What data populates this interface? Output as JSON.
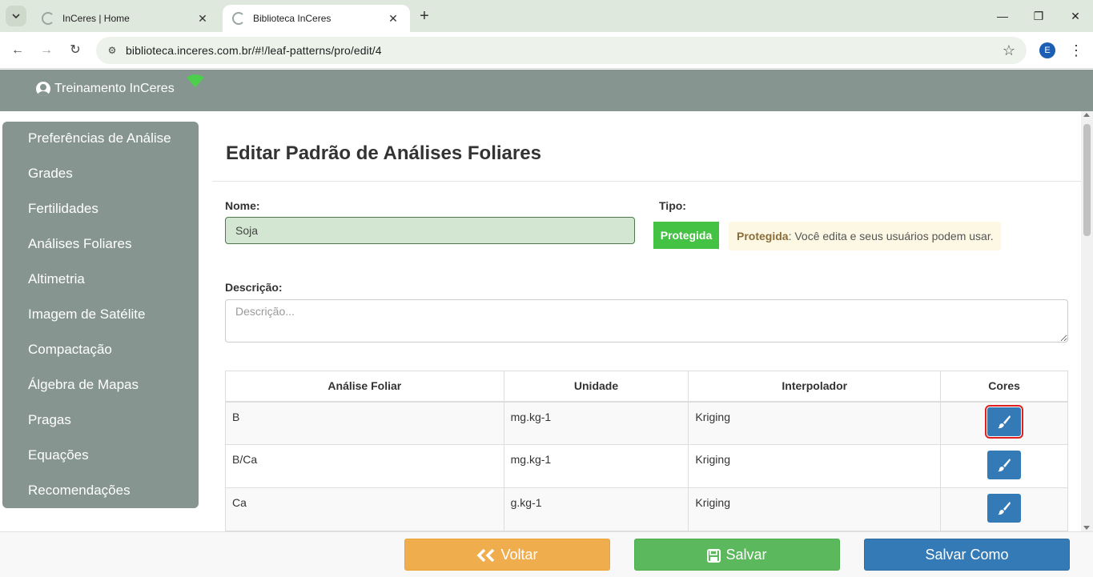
{
  "browser": {
    "tabs": [
      {
        "title": "InCeres | Home"
      },
      {
        "title": "Biblioteca InCeres"
      }
    ],
    "url": "biblioteca.inceres.com.br/#!/leaf-patterns/pro/edit/4",
    "profile_initial": "E"
  },
  "header": {
    "user_name": "Treinamento InCeres"
  },
  "sidebar": {
    "items": [
      {
        "label": "Preferências de Análise"
      },
      {
        "label": "Grades"
      },
      {
        "label": "Fertilidades"
      },
      {
        "label": "Análises Foliares"
      },
      {
        "label": "Altimetria"
      },
      {
        "label": "Imagem de Satélite"
      },
      {
        "label": "Compactação"
      },
      {
        "label": "Álgebra de Mapas"
      },
      {
        "label": "Pragas"
      },
      {
        "label": "Equações"
      },
      {
        "label": "Recomendações"
      }
    ]
  },
  "main": {
    "title": "Editar Padrão de Análises Foliares",
    "name_label": "Nome:",
    "name_value": "Soja",
    "type_label": "Tipo:",
    "type_button": "Protegida",
    "type_note_bold": "Protegida",
    "type_note_text": ": Você edita e seus usuários podem usar.",
    "description_label": "Descrição:",
    "description_placeholder": "Descrição...",
    "table": {
      "headers": [
        "Análise Foliar",
        "Unidade",
        "Interpolador",
        "Cores"
      ],
      "rows": [
        {
          "analise": "B",
          "unidade": "mg.kg-1",
          "interpolador": "Kriging"
        },
        {
          "analise": "B/Ca",
          "unidade": "mg.kg-1",
          "interpolador": "Kriging"
        },
        {
          "analise": "Ca",
          "unidade": "g.kg-1",
          "interpolador": "Kriging"
        }
      ]
    }
  },
  "footer": {
    "back_label": "Voltar",
    "save_label": "Salvar",
    "save_as_label": "Salvar Como"
  },
  "colors": {
    "header_bg": "#86958f",
    "primary": "#337ab7",
    "success": "#5cb85c",
    "warning": "#f0ad4e",
    "protected": "#43c243"
  },
  "icons": [
    "menu-icon",
    "reload-icon",
    "star-icon",
    "user-icon",
    "wifi-icon",
    "brush-icon",
    "chevrons-left-icon",
    "floppy-icon"
  ]
}
